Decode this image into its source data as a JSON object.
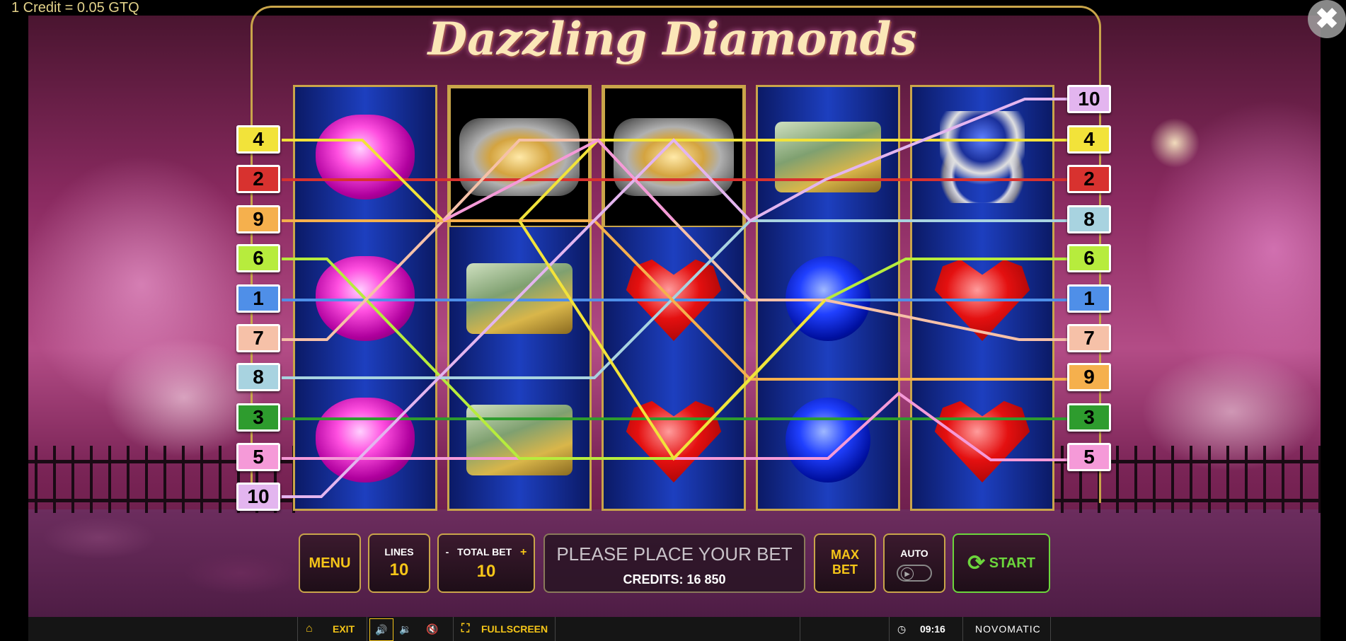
{
  "header": {
    "credit_note": "1 Credit = 0.05 GTQ",
    "close_label": "✖",
    "game_title": "Dazzling Diamonds"
  },
  "paylines": {
    "left": [
      {
        "label": "4",
        "color": "#f2e33a"
      },
      {
        "label": "2",
        "color": "#d8322f"
      },
      {
        "label": "9",
        "color": "#f5b04d"
      },
      {
        "label": "6",
        "color": "#b7ec3d"
      },
      {
        "label": "1",
        "color": "#4f8fe8"
      },
      {
        "label": "7",
        "color": "#f6c1a8"
      },
      {
        "label": "8",
        "color": "#a8d3e0"
      },
      {
        "label": "3",
        "color": "#2e9c2e"
      },
      {
        "label": "5",
        "color": "#f59ad8"
      },
      {
        "label": "10",
        "color": "#e3b5ef"
      }
    ],
    "right": [
      {
        "label": "10",
        "color": "#e3b5ef"
      },
      {
        "label": "4",
        "color": "#f2e33a"
      },
      {
        "label": "2",
        "color": "#d8322f"
      },
      {
        "label": "8",
        "color": "#a8d3e0"
      },
      {
        "label": "6",
        "color": "#b7ec3d"
      },
      {
        "label": "1",
        "color": "#4f8fe8"
      },
      {
        "label": "7",
        "color": "#f6c1a8"
      },
      {
        "label": "9",
        "color": "#f5b04d"
      },
      {
        "label": "3",
        "color": "#2e9c2e"
      },
      {
        "label": "5",
        "color": "#f59ad8"
      }
    ]
  },
  "reels": [
    [
      "pink-diamond",
      "pink-diamond",
      "pink-diamond"
    ],
    [
      "gold-watch",
      "money-stack",
      "money-stack"
    ],
    [
      "gold-watch",
      "red-heart",
      "red-heart"
    ],
    [
      "money-stack",
      "blue-diamond",
      "blue-diamond"
    ],
    [
      "sapphire-ring",
      "red-heart",
      "red-heart"
    ]
  ],
  "controls": {
    "menu_label": "MENU",
    "lines_label": "LINES",
    "lines_value": "10",
    "bet_minus": "-",
    "bet_label": "TOTAL BET",
    "bet_plus": "+",
    "bet_value": "10",
    "message": "PLEASE PLACE YOUR BET",
    "credits": "CREDITS: 16 850",
    "maxbet_line1": "MAX",
    "maxbet_line2": "BET",
    "auto_label": "AUTO",
    "start_label": "START"
  },
  "taskbar": {
    "exit_label": "EXIT",
    "fullscreen_label": "FULLSCREEN",
    "clock": "09:16",
    "brand": "NOVOMATIC"
  }
}
